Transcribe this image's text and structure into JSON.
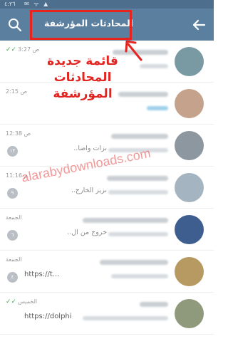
{
  "status_bar": {
    "time": "٤:٢٦",
    "icons": "✉ ᯤ ▲"
  },
  "header": {
    "title": "المحادثات المؤرشفة",
    "back_icon": "arrow-left-icon",
    "search_icon": "search-icon",
    "background": "#5b7f9f"
  },
  "annotation": {
    "line1": "قائمة جديدة",
    "line2": "المحادثات",
    "line3": "المؤرشفة",
    "color": "#e32522"
  },
  "watermark": "alarabydownloads.com",
  "chats": [
    {
      "time": "3:27 ص",
      "read": true,
      "unread": "",
      "preview": "",
      "avatar": "#7a9aa3"
    },
    {
      "time": "2:15 ص",
      "read": false,
      "unread": "",
      "preview": "",
      "avatar": "#c5a28c"
    },
    {
      "time": "12:38 ص",
      "read": false,
      "unread": "١٣",
      "preview": "ىزات واضا..",
      "avatar": "#8c97a0"
    },
    {
      "time": "11:16 م",
      "read": false,
      "unread": "٩",
      "preview": "ىزير الخارج..",
      "avatar": "#a4b4c0"
    },
    {
      "time": "الجمعة",
      "read": false,
      "unread": "٦",
      "preview": "خروج من ال..",
      "avatar": "#3f5e90"
    },
    {
      "time": "الجمعة",
      "read": false,
      "unread": "٤",
      "preview": "https://t...",
      "avatar": "#b79a62"
    },
    {
      "time": "الخميس",
      "read": true,
      "unread": "",
      "preview": "https://dolphi",
      "avatar": "#8f9a7c"
    }
  ]
}
